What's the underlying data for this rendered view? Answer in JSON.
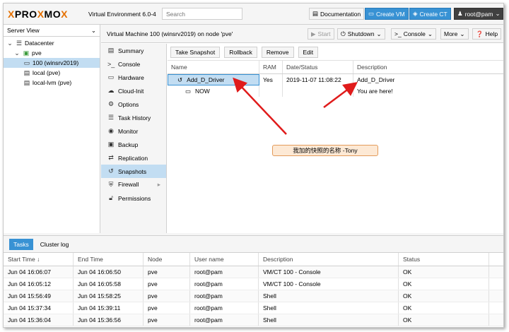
{
  "topbar": {
    "logo_left": "PRO",
    "logo_x": "X",
    "logo_right": "MO",
    "logo_x2": "X",
    "version": "Virtual Environment 6.0-4",
    "search_placeholder": "Search",
    "documentation": "Documentation",
    "create_vm": "Create VM",
    "create_ct": "Create CT",
    "user": "root@pam"
  },
  "tree": {
    "view": "Server View",
    "items": [
      "Datacenter",
      "pve",
      "100 (winsrv2019)",
      "local (pve)",
      "local-lvm (pve)"
    ]
  },
  "content": {
    "title": "Virtual Machine 100 (winsrv2019) on node 'pve'",
    "start": "Start",
    "shutdown": "Shutdown",
    "console": "Console",
    "more": "More",
    "help": "Help"
  },
  "vmnav": [
    "Summary",
    "Console",
    "Hardware",
    "Cloud-Init",
    "Options",
    "Task History",
    "Monitor",
    "Backup",
    "Replication",
    "Snapshots",
    "Firewall",
    "Permissions"
  ],
  "snapshots": {
    "buttons": [
      "Take Snapshot",
      "Rollback",
      "Remove",
      "Edit"
    ],
    "columns": [
      "Name",
      "RAM",
      "Date/Status",
      "Description"
    ],
    "rows": [
      {
        "name": "Add_D_Driver",
        "ram": "Yes",
        "date": "2019-11-07 11:08:22",
        "desc": "Add_D_Driver"
      },
      {
        "name": "NOW",
        "ram": "",
        "date": "",
        "desc": "You are here!"
      }
    ]
  },
  "annotation": "我加的快照的名称 -Tony",
  "tasks": {
    "tabs": [
      "Tasks",
      "Cluster log"
    ],
    "columns": [
      "Start Time ↓",
      "End Time",
      "Node",
      "User name",
      "Description",
      "Status"
    ],
    "rows": [
      [
        "Jun 04 16:06:07",
        "Jun 04 16:06:50",
        "pve",
        "root@pam",
        "VM/CT 100 - Console",
        "OK"
      ],
      [
        "Jun 04 16:05:12",
        "Jun 04 16:05:58",
        "pve",
        "root@pam",
        "VM/CT 100 - Console",
        "OK"
      ],
      [
        "Jun 04 15:56:49",
        "Jun 04 15:58:25",
        "pve",
        "root@pam",
        "Shell",
        "OK"
      ],
      [
        "Jun 04 15:37:34",
        "Jun 04 15:39:11",
        "pve",
        "root@pam",
        "Shell",
        "OK"
      ],
      [
        "Jun 04 15:36:04",
        "Jun 04 15:36:56",
        "pve",
        "root@pam",
        "Shell",
        "OK"
      ]
    ]
  },
  "colors": {
    "accent": "#3892d4",
    "selection": "#c2ddf2",
    "arrow": "#e01b1b",
    "logo_x": "#e57000"
  }
}
